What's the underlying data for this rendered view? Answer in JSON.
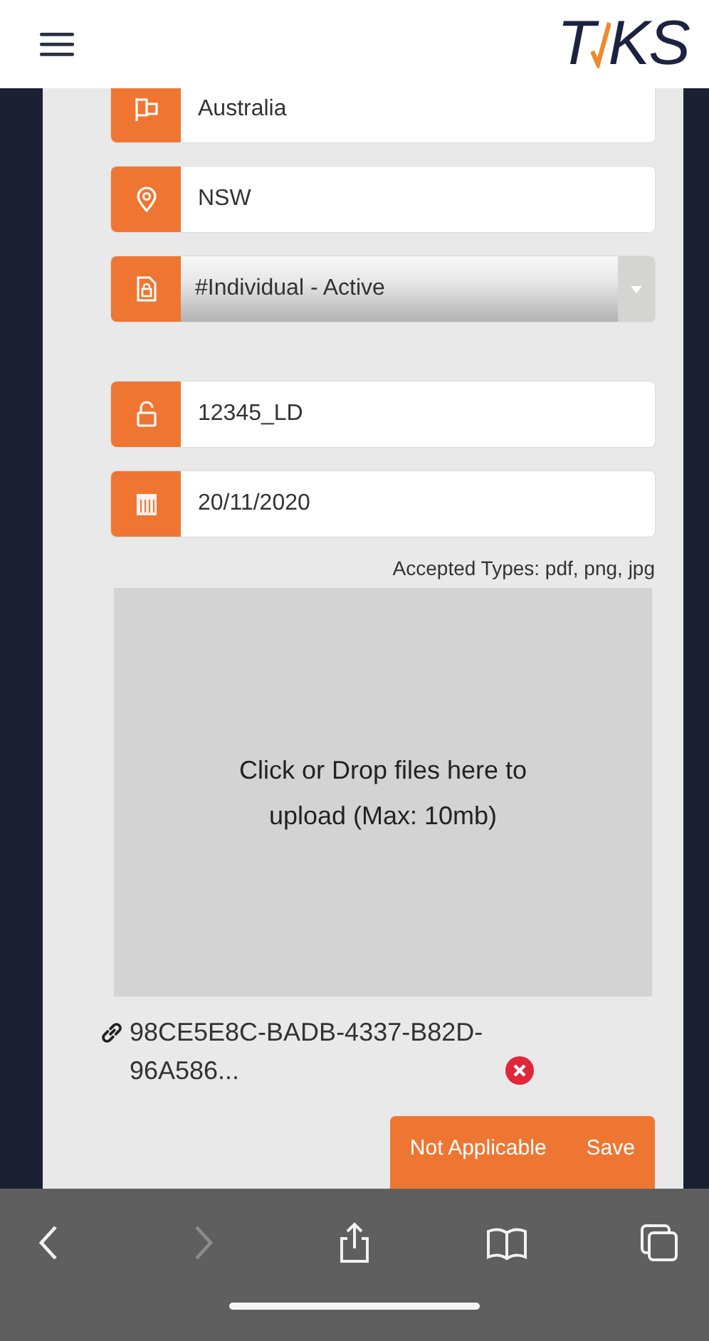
{
  "header": {
    "logo_left": "T",
    "logo_right": "KS"
  },
  "fields": [
    {
      "kind": "text",
      "value": "Australia"
    },
    {
      "kind": "text",
      "value": "NSW"
    },
    {
      "kind": "select",
      "value": "#Individual - Active"
    },
    {
      "kind": "text",
      "value": "12345_LD"
    },
    {
      "kind": "text",
      "value": "20/11/2020"
    }
  ],
  "accepted_types": "Accepted Types: pdf, png, jpg",
  "upload": {
    "text": "Click or Drop files here to upload (Max: 10mb)"
  },
  "attachment": {
    "name": "98CE5E8C-BADB-4337-B82D-96A586..."
  },
  "buttons": [
    "Not Applicable",
    "Save"
  ],
  "toolbar": [
    {
      "kind": "back",
      "disabled": false
    },
    {
      "kind": "forward",
      "disabled": true
    },
    {
      "kind": "share",
      "disabled": false
    },
    {
      "kind": "bookmarks",
      "disabled": false
    },
    {
      "kind": "tabs",
      "disabled": false
    }
  ]
}
